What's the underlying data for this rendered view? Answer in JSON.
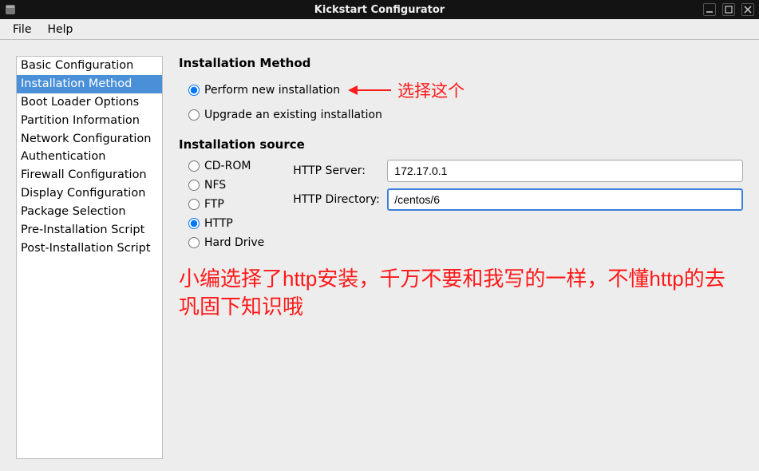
{
  "window": {
    "title": "Kickstart Configurator"
  },
  "menubar": {
    "file": "File",
    "help": "Help"
  },
  "sidebar": {
    "items": [
      "Basic Configuration",
      "Installation Method",
      "Boot Loader Options",
      "Partition Information",
      "Network Configuration",
      "Authentication",
      "Firewall Configuration",
      "Display Configuration",
      "Package Selection",
      "Pre-Installation Script",
      "Post-Installation Script"
    ],
    "selected_index": 1
  },
  "main": {
    "installation_method": {
      "heading": "Installation Method",
      "options": {
        "new": "Perform new installation",
        "upgrade": "Upgrade an existing installation"
      },
      "selected": "new"
    },
    "installation_source": {
      "heading": "Installation source",
      "options": {
        "cdrom": "CD-ROM",
        "nfs": "NFS",
        "ftp": "FTP",
        "http": "HTTP",
        "harddrive": "Hard Drive"
      },
      "selected": "http",
      "http_server_label": "HTTP Server:",
      "http_server_value": "172.17.0.1",
      "http_directory_label": "HTTP Directory:",
      "http_directory_value": "/centos/6"
    }
  },
  "annotations": {
    "choose_this": "选择这个",
    "note": "小编选择了http安装，千万不要和我写的一样，不懂http的去巩固下知识哦"
  }
}
